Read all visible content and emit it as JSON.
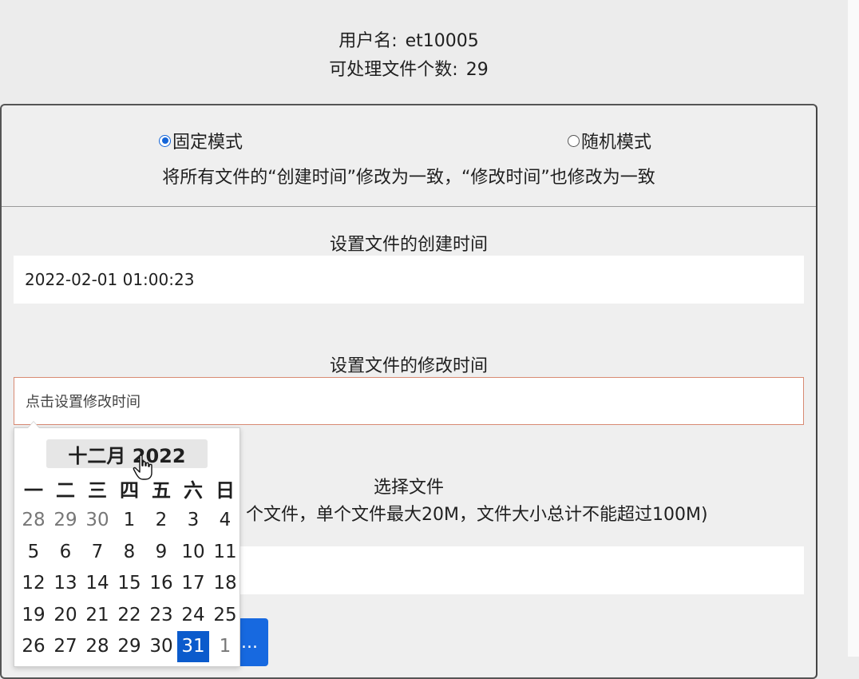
{
  "header": {
    "username_label": "用户名:",
    "username_value": "et10005",
    "file_count_label": "可处理文件个数:",
    "file_count_value": "29"
  },
  "modes": {
    "fixed_label": "固定模式",
    "random_label": "随机模式",
    "selected": "fixed",
    "description": "将所有文件的“创建时间”修改为一致，“修改时间”也修改为一致"
  },
  "create_time": {
    "title": "设置文件的创建时间",
    "value": "2022-02-01 01:00:23"
  },
  "modify_time": {
    "title": "设置文件的修改时间",
    "placeholder": "点击设置修改时间"
  },
  "file_select": {
    "title": "选择文件",
    "hint": "个文件，单个文件最大20M，文件大小总计不能超过100M)",
    "button_label": "..."
  },
  "calendar": {
    "month_year": "十二月 2022",
    "weekdays": [
      "一",
      "二",
      "三",
      "四",
      "五",
      "六",
      "日"
    ],
    "weeks": [
      [
        "28",
        "29",
        "30",
        "1",
        "2",
        "3",
        "4"
      ],
      [
        "5",
        "6",
        "7",
        "8",
        "9",
        "10",
        "11"
      ],
      [
        "12",
        "13",
        "14",
        "15",
        "16",
        "17",
        "18"
      ],
      [
        "19",
        "20",
        "21",
        "22",
        "23",
        "24",
        "25"
      ],
      [
        "26",
        "27",
        "28",
        "29",
        "30",
        "31",
        "1"
      ]
    ],
    "other_month_days": [
      "0-0",
      "0-1",
      "0-2",
      "4-6"
    ],
    "selected_day": "4-5"
  },
  "colors": {
    "accent": "#1565d8",
    "selected_day_bg": "#0b5bcc",
    "active_field_border": "#d88a73",
    "upload_button_bg": "#1769e0"
  }
}
